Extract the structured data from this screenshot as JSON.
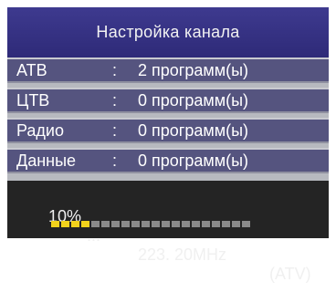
{
  "title": "Настройка канала",
  "rows": [
    {
      "label": "АТВ",
      "separator": ":",
      "value": "2 программ(ы)"
    },
    {
      "label": "ЦТВ",
      "separator": ":",
      "value": "0 программ(ы)"
    },
    {
      "label": "Радио",
      "separator": ":",
      "value": "0 программ(ы)"
    },
    {
      "label": "Данные",
      "separator": ":",
      "value": "0 программ(ы)"
    }
  ],
  "status": {
    "percent": "10%",
    "ellipsis": "...",
    "frequency": "223. 20MHz",
    "mode": "(ATV)"
  },
  "progress": {
    "segments_total": 20,
    "segments_filled": 4
  },
  "colors": {
    "title_bg": "#3e3a8f",
    "row_bg": "#55547f",
    "status_bg": "#242424",
    "progress_on": "#f2d21c",
    "progress_off": "#8a8a8a"
  }
}
